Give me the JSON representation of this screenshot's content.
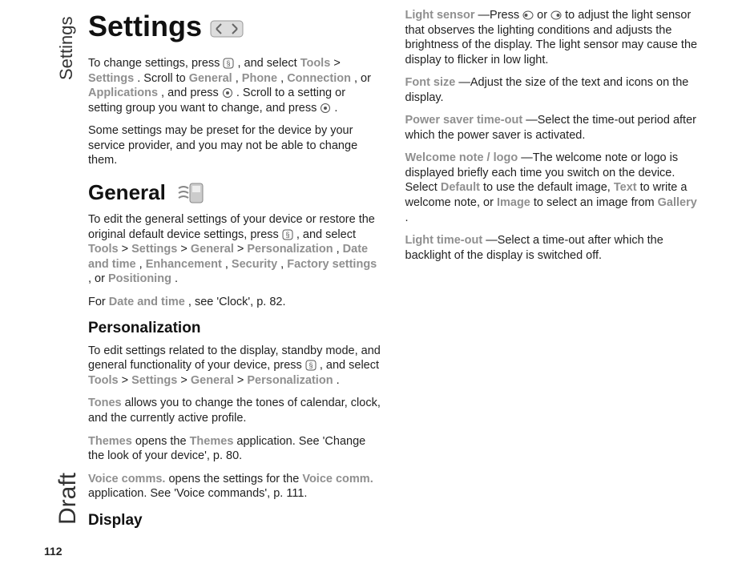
{
  "margin": {
    "section_label": "Settings",
    "draft_label": "Draft",
    "page_number": "112"
  },
  "h1": "Settings",
  "p1a": "To change settings, press ",
  "p1b": " , and select ",
  "p1_tools": "Tools",
  "p1_gt1": " > ",
  "p1_settings": "Settings",
  "p1c": ". Scroll to ",
  "p1_general": "General",
  "p1_comma1": ", ",
  "p1_phone": "Phone",
  "p1_comma2": ", ",
  "p1_connection": "Connection",
  "p1_or1": ", or ",
  "p1_applications": "Applications",
  "p1d": ", and press ",
  "p1e": ". Scroll to a setting or setting group you want to change, and press ",
  "p1f": ".",
  "p2": "Some settings may be preset for the device by your service provider, and you may not be able to change them.",
  "h2_general": "General",
  "p3a": "To edit the general settings of your device or restore the original default device settings,  press ",
  "p3b": " , and select ",
  "p3_tools": "Tools",
  "p3_gt1": " > ",
  "p3_settings": "Settings",
  "p3_gt2": " > ",
  "p3_general": "General",
  "p3_gt3": "  > ",
  "p3_personalization": "Personalization",
  "p3_comma1": ", ",
  "p3_datetime": "Date and time",
  "p3_comma2": ", ",
  "p3_enhancement": "Enhancement",
  "p3_comma3": ", ",
  "p3_security": "Security",
  "p3_comma4": ", ",
  "p3_factory": "Factory settings",
  "p3_or": ", or ",
  "p3_positioning": "Positioning",
  "p3_end": ".",
  "p4a": "For ",
  "p4_datetime": "Date and time",
  "p4b": ", see 'Clock', p.  82.",
  "h3_personalization": "Personalization",
  "p5a": "To edit settings related to the display, standby mode, and general functionality of your device, press ",
  "p5b": " , and select ",
  "p5_tools": "Tools",
  "p5_gt1": " > ",
  "p5_settings": "Settings",
  "p5_gt2": " > ",
  "p5_general": "General",
  "p5_gt3": " > ",
  "p5_personalization": "Personalization",
  "p5_end": ".",
  "p6_tones": "Tones",
  "p6_rest": " allows you to change the tones of calendar, clock, and the currently active profile.",
  "p7_themes": "Themes",
  "p7a": " opens the ",
  "p7_themes2": "Themes",
  "p7b": " application. See 'Change the look of your device', p. 80.",
  "p8_vc": "Voice comms.",
  "p8a": " opens the settings for the ",
  "p8_vc2": "Voice comm.",
  "p8b": " application. See 'Voice commands', p. 111.",
  "h3_display": "Display",
  "p9_ls": "Light sensor",
  "p9a": "—Press ",
  "p9b": " or ",
  "p9c": " to adjust the light sensor that observes the lighting conditions and adjusts the brightness of the display. The light sensor may cause the display to flicker in low light.",
  "p10_fs": "Font size",
  "p10a": "—Adjust the size of the text and icons on the display.",
  "p11_ps": "Power saver time-out",
  "p11a": "—Select the time-out period after which the power saver is activated.",
  "p12_wn": "Welcome note / logo",
  "p12a": "—The welcome note or logo is displayed briefly each time you switch on the device. Select ",
  "p12_default": "Default",
  "p12b": " to use the default image, ",
  "p12_text": "Text",
  "p12c": " to write a welcome note, or ",
  "p12_image": "Image",
  "p12d": " to select an image from ",
  "p12_gallery": "Gallery",
  "p12e": ".",
  "p13_lt": "Light time-out",
  "p13a": "—Select a time-out after which the backlight of the display is switched off."
}
